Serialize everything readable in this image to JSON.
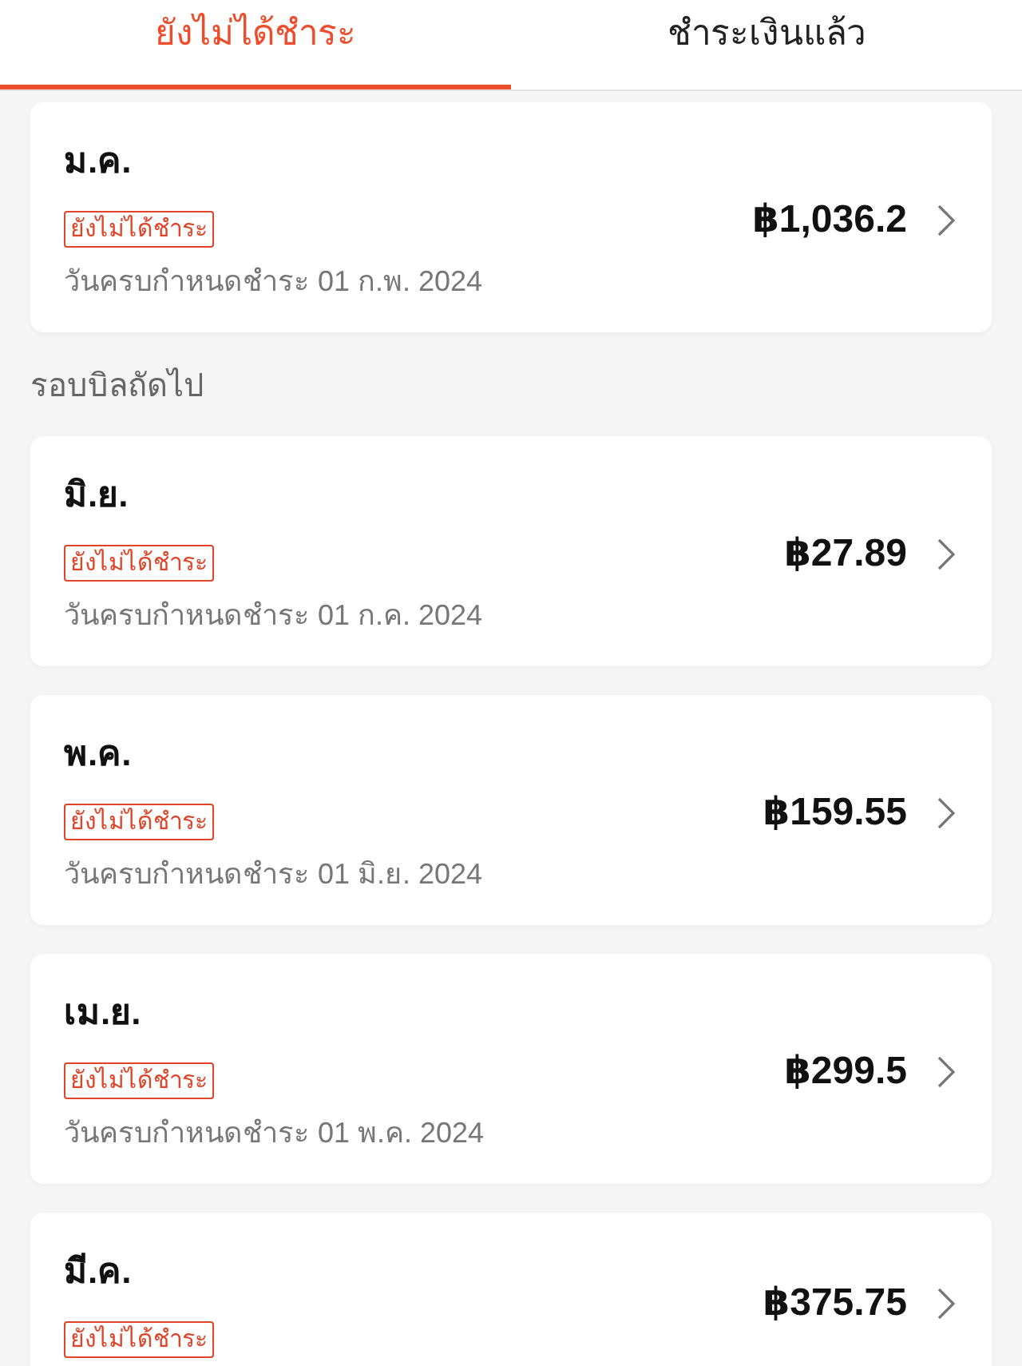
{
  "tabs": [
    {
      "label": "ยังไม่ได้ชำระ",
      "selected": true
    },
    {
      "label": "ชำระเงินแล้ว",
      "selected": false
    }
  ],
  "current_bills": [
    {
      "month": "ม.ค.",
      "badge": "ยังไม่ได้ชำระ",
      "due": "วันครบกำหนดชำระ 01 ก.พ. 2024",
      "amount": "฿1,036.2"
    }
  ],
  "next_section": {
    "title": "รอบบิลถัดไป",
    "bills": [
      {
        "month": "มิ.ย.",
        "badge": "ยังไม่ได้ชำระ",
        "due": "วันครบกำหนดชำระ 01 ก.ค. 2024",
        "amount": "฿27.89"
      },
      {
        "month": "พ.ค.",
        "badge": "ยังไม่ได้ชำระ",
        "due": "วันครบกำหนดชำระ 01 มิ.ย. 2024",
        "amount": "฿159.55"
      },
      {
        "month": "เม.ย.",
        "badge": "ยังไม่ได้ชำระ",
        "due": "วันครบกำหนดชำระ 01 พ.ค. 2024",
        "amount": "฿299.5"
      },
      {
        "month": "มี.ค.",
        "badge": "ยังไม่ได้ชำระ",
        "amount": "฿375.75"
      }
    ]
  }
}
